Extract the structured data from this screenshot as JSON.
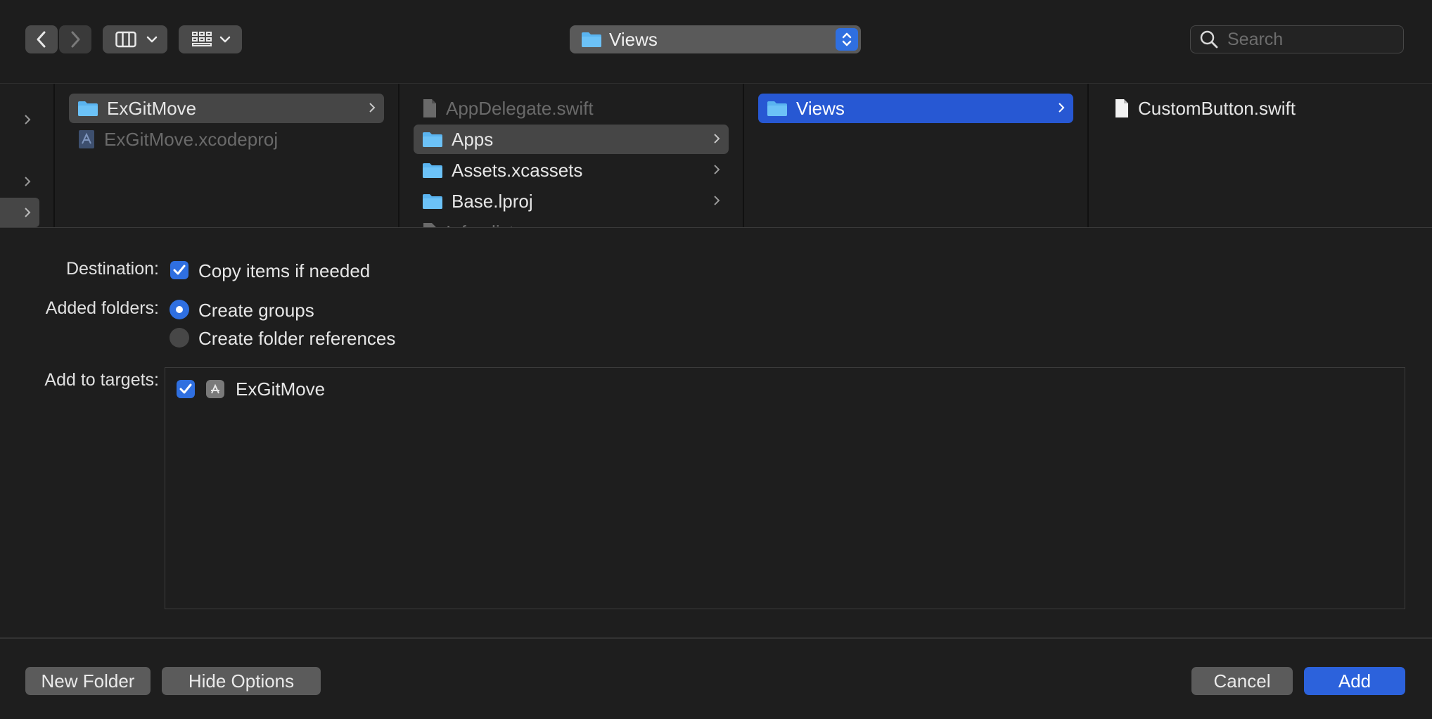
{
  "toolbar": {
    "back_icon": "chevron-left-icon",
    "forward_icon": "chevron-right-icon",
    "view_mode_icon": "column-view-icon",
    "group_icon": "grid-view-icon",
    "path_popup_label": "Views",
    "search_placeholder": "Search"
  },
  "browser": {
    "columns": [
      {
        "items": [
          {
            "label": "ExGitMove",
            "type": "folder",
            "state": "selected-inactive",
            "has_children": true
          },
          {
            "label": "ExGitMove.xcodeproj",
            "type": "xcodeproj",
            "state": "disabled",
            "has_children": false
          }
        ]
      },
      {
        "items": [
          {
            "label": "AppDelegate.swift",
            "type": "swift-file",
            "state": "disabled",
            "has_children": false
          },
          {
            "label": "Apps",
            "type": "folder",
            "state": "selected-inactive",
            "has_children": true
          },
          {
            "label": "Assets.xcassets",
            "type": "folder",
            "state": "normal",
            "has_children": true
          },
          {
            "label": "Base.lproj",
            "type": "folder",
            "state": "normal",
            "has_children": true
          },
          {
            "label": "Info.plist",
            "type": "file",
            "state": "disabled-clipped",
            "has_children": false
          }
        ]
      },
      {
        "items": [
          {
            "label": "Views",
            "type": "folder",
            "state": "selected-active",
            "has_children": true
          }
        ]
      },
      {
        "items": [
          {
            "label": "CustomButton.swift",
            "type": "swift-file",
            "state": "normal",
            "has_children": false
          }
        ]
      }
    ]
  },
  "options": {
    "destination_label": "Destination:",
    "copy_items_label": "Copy items if needed",
    "copy_items_checked": true,
    "added_folders_label": "Added folders:",
    "create_groups_label": "Create groups",
    "create_folder_refs_label": "Create folder references",
    "added_folders_selected": "Create groups",
    "targets_label": "Add to targets:",
    "targets": [
      {
        "name": "ExGitMove",
        "checked": true,
        "icon": "app-target-icon"
      }
    ]
  },
  "footer": {
    "new_folder_label": "New Folder",
    "hide_options_label": "Hide Options",
    "cancel_label": "Cancel",
    "add_label": "Add"
  },
  "colors": {
    "accent": "#2f6fe0",
    "selection_active": "#2758d3",
    "selection_inactive": "#464646",
    "background": "#1e1e1e",
    "folder": "#5ab4f0"
  }
}
